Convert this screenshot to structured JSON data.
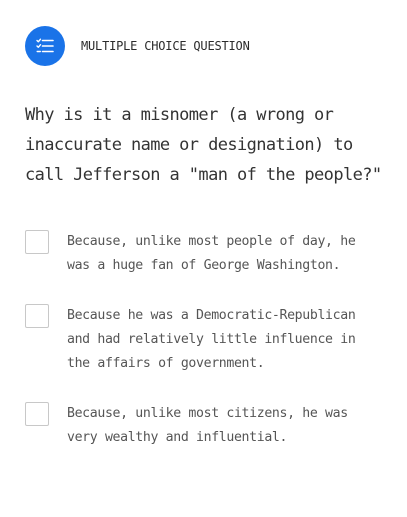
{
  "header": {
    "icon": "checklist-icon",
    "accent_color": "#1a73e8",
    "type_label": "MULTIPLE CHOICE QUESTION"
  },
  "question": {
    "text": "Why is it a misnomer (a wrong or inaccurate name or designation) to call Jefferson a \"man of the people?\""
  },
  "options": [
    {
      "text": "Because, unlike most people of day, he was a huge fan of George Washington.",
      "checked": false
    },
    {
      "text": "Because he was a Democratic-Republican and had relatively little influence in the affairs of government.",
      "checked": false
    },
    {
      "text": "Because, unlike most citizens, he was very wealthy and influential.",
      "checked": false
    }
  ]
}
